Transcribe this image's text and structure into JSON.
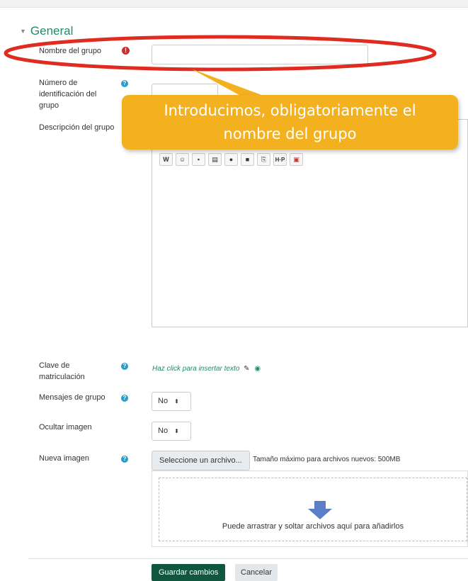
{
  "section": {
    "title": "General"
  },
  "fields": {
    "group_name_label": "Nombre del grupo",
    "group_idnumber_label": "Número de identificación del grupo",
    "group_description_label": "Descripción del grupo",
    "enrolment_key_label": "Clave de matriculación",
    "enrolment_key_placeholder": "Haz click para insertar texto",
    "group_messaging_label": "Mensajes de grupo",
    "group_messaging_value": "No",
    "hide_picture_label": "Ocultar imagen",
    "hide_picture_value": "No",
    "new_picture_label": "Nueva imagen"
  },
  "filepicker": {
    "choose_button": "Seleccione un archivo...",
    "max_size": "Tamaño máximo para archivos nuevos: 500MB",
    "drop_message": "Puede arrastrar y soltar archivos aquí para añadirlos"
  },
  "actions": {
    "save": "Guardar cambios",
    "cancel": "Cancelar"
  },
  "callout": {
    "line1": "Introducimos, obligatoriamente el",
    "line2": "nombre del grupo"
  },
  "editor_toolbar": [
    "word-icon",
    "emoticon-icon",
    "image-icon",
    "media-icon",
    "record-audio-icon",
    "record-video-icon",
    "manage-files-icon",
    "h5p-icon",
    "pdf-icon"
  ],
  "colors": {
    "accent_green": "#1f8a6d",
    "save_button": "#11563f",
    "callout": "#f3b11f",
    "highlight_ellipse": "#e02b20",
    "help_icon": "#2a9cc8",
    "required_icon": "#c53030"
  }
}
